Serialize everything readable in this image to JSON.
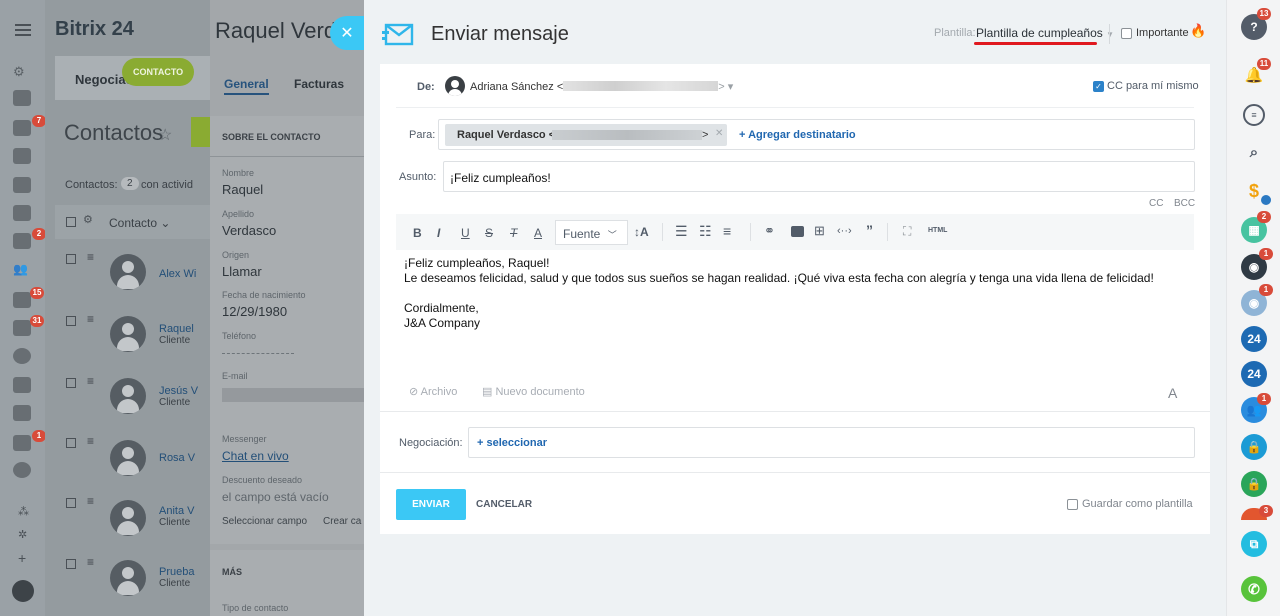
{
  "bg": {
    "logo": "Bitrix 24",
    "nav_tab": "Negociac",
    "contact_tab": "CONTACTO",
    "page_title": "Contactos",
    "filter_text": "Contactos:",
    "filter_count": "2",
    "filter_suffix": "con activid",
    "column_header": "Contacto",
    "rows": [
      {
        "name": "Alex Wi",
        "type": ""
      },
      {
        "name": "Raquel",
        "type": "Cliente"
      },
      {
        "name": "Jesús V",
        "type": "Cliente"
      },
      {
        "name": "Rosa V",
        "type": ""
      },
      {
        "name": "Anita V",
        "type": "Cliente"
      },
      {
        "name": "Prueba",
        "type": "Cliente"
      }
    ],
    "left_badges": [
      "7",
      "2",
      "15",
      "31",
      "1"
    ]
  },
  "card": {
    "title": "Raquel Verd",
    "tabs": [
      "General",
      "Facturas"
    ],
    "section": "SOBRE EL CONTACTO",
    "fields": [
      {
        "label": "Nombre",
        "value": "Raquel"
      },
      {
        "label": "Apellido",
        "value": "Verdasco"
      },
      {
        "label": "Origen",
        "value": "Llamar"
      },
      {
        "label": "Fecha de nacimiento",
        "value": "12/29/1980"
      },
      {
        "label": "Teléfono",
        "value": ""
      },
      {
        "label": "E-mail",
        "value": ""
      }
    ],
    "messenger_label": "Messenger",
    "messenger_value": "Chat en vivo",
    "desc_label": "Descuento deseado",
    "desc_value": "el campo está vacío",
    "select_field": "Seleccionar campo",
    "create_field": "Crear ca",
    "more": "MÁS",
    "tipo": "Tipo de contacto"
  },
  "panel": {
    "title": "Enviar mensaje",
    "template_label": "Plantilla:",
    "template_value": "Plantilla de cumpleaños",
    "important_label": "Importante",
    "from_label": "De:",
    "from_name": "Adriana Sánchez <",
    "from_tail": "> ▾",
    "cc_self_label": "CC para mí mismo",
    "to_label": "Para:",
    "to_name": "Raquel Verdasco <",
    "to_tail": ">",
    "add_recipient": "+ Agregar destinatario",
    "subject_label": "Asunto:",
    "subject_value": "¡Feliz cumpleaños!",
    "cc": "CC",
    "bcc": "BCC",
    "toolbar": {
      "bold": "B",
      "italic": "I",
      "underline": "U",
      "strike": "S",
      "clear": "T",
      "color": "A",
      "font": "Fuente",
      "html": "HTML"
    },
    "body_lines": [
      "¡Feliz cumpleaños, Raquel!",
      "Le deseamos felicidad, salud y que todos sus sueños se hagan realidad. ¡Qué viva esta fecha con alegría y tenga una vida llena de felicidad!",
      "",
      "Cordialmente,",
      "J&A Company"
    ],
    "attach_file": "Archivo",
    "new_document": "Nuevo documento",
    "format_letter": "A",
    "deal_label": "Negociación:",
    "deal_select": "+ seleccionar",
    "send": "ENVIAR",
    "cancel": "CANCELAR",
    "save_template": "Guardar como plantilla"
  },
  "right": {
    "badges": [
      "13",
      "11",
      "2",
      "1",
      "1",
      "1",
      "3"
    ],
    "b24": "24"
  },
  "colors": {
    "accent_blue": "#3bc8f5",
    "link_blue": "#2067b0",
    "underline_red": "#e0191f",
    "badge_red": "#d84b3a",
    "green_phone": "#58c33b"
  }
}
